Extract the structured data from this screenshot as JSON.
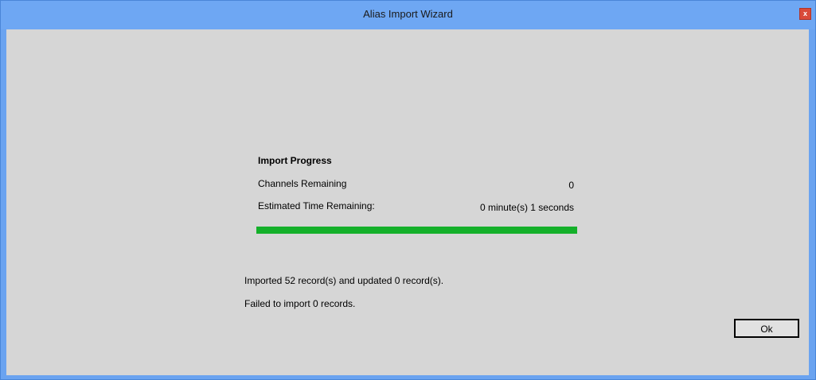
{
  "window": {
    "title": "Alias Import Wizard",
    "close_glyph": "x"
  },
  "import_progress": {
    "heading": "Import Progress",
    "channels_remaining_label": "Channels Remaining",
    "channels_remaining_value": "0",
    "estimated_time_label": "Estimated Time Remaining:",
    "estimated_time_value": "0 minute(s) 1 seconds",
    "progress_percent": 100
  },
  "messages": {
    "imported": "Imported 52 record(s) and updated 0 record(s).",
    "failed": "Failed to import 0 records."
  },
  "buttons": {
    "ok_label": "Ok"
  },
  "colors": {
    "titlebar": "#6ea7f3",
    "client_background": "#d6d6d6",
    "progress_fill": "#14b02a",
    "close_button": "#d94a3a"
  },
  "icons": {
    "close": "close-icon"
  }
}
